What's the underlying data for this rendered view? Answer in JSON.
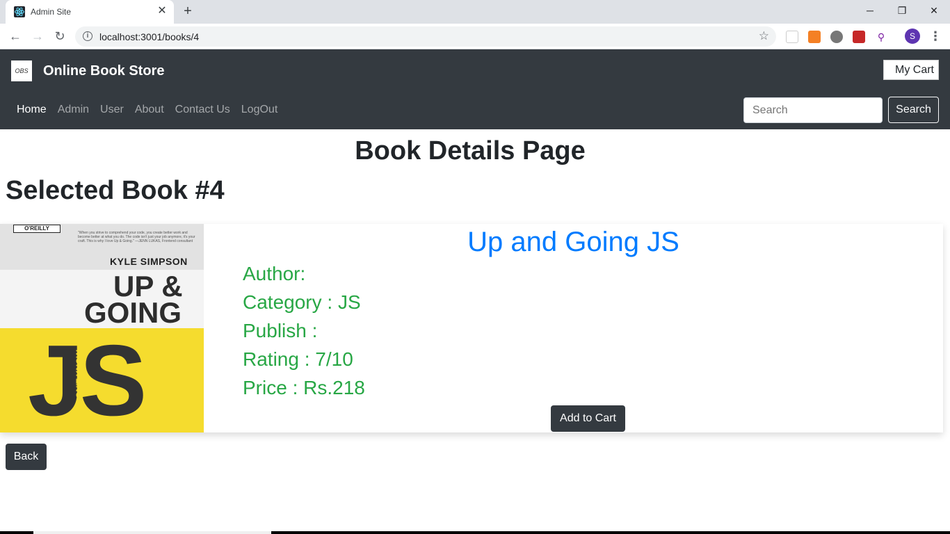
{
  "browser": {
    "tab_title": "Admin Site",
    "tab_close": "✕",
    "new_tab": "+",
    "window_controls": [
      "─",
      "❐",
      "✕"
    ],
    "url": "localhost:3001/books/4",
    "profile_initial": "S"
  },
  "navbar": {
    "brand_logo_text": "OBS",
    "brand_name": "Online Book Store",
    "cart_label": "My Cart",
    "links": [
      {
        "label": "Home",
        "active": true
      },
      {
        "label": "Admin",
        "active": false
      },
      {
        "label": "User",
        "active": false
      },
      {
        "label": "About",
        "active": false
      },
      {
        "label": "Contact Us",
        "active": false
      },
      {
        "label": "LogOut",
        "active": false
      }
    ],
    "search_placeholder": "Search",
    "search_button": "Search"
  },
  "page": {
    "title": "Book Details Page",
    "selected_heading": "Selected Book #4"
  },
  "book": {
    "cover": {
      "publisher": "O'REILLY",
      "blurb": "\"When you strive to comprehend your code, you create better work and become better at what you do. The code isn't just your job anymore, it's your craft. This is why I love Up & Going.\" —JENN LUKAS, Frontend consultant",
      "author": "KYLE SIMPSON",
      "title_line1": "UP &",
      "title_line2": "GOING",
      "big_text": "JS",
      "series": "YOU DON'T KNOW"
    },
    "title": "Up and Going JS",
    "author_line": "Author:",
    "category_line": "Category : JS",
    "publish_line": "Publish :",
    "rating_line": "Rating : 7/10",
    "price_line": "Price : Rs.218",
    "add_to_cart": "Add to Cart"
  },
  "actions": {
    "back": "Back"
  }
}
